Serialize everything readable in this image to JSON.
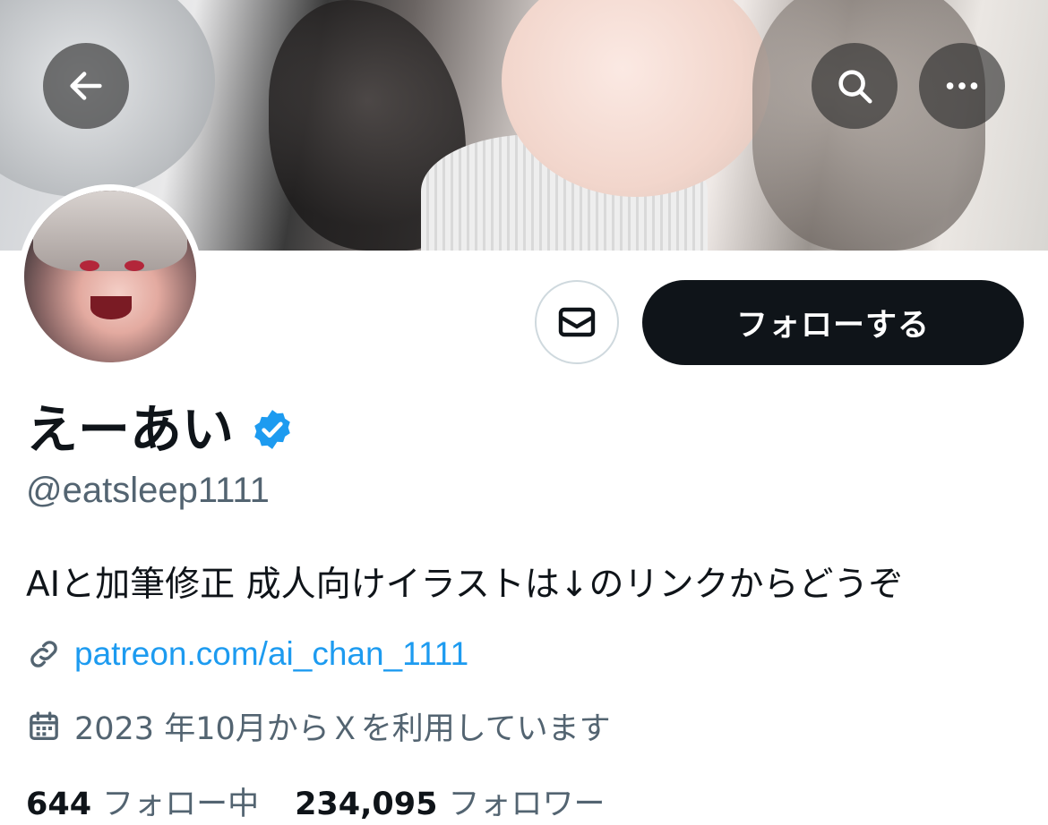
{
  "header": {
    "back_icon": "arrow-left-icon",
    "search_icon": "search-icon",
    "more_icon": "more-horizontal-icon"
  },
  "profile": {
    "name": "えーあい",
    "verified": true,
    "handle": "@eatsleep1111",
    "bio": "AIと加筆修正 成人向けイラストは↓のリンクからどうぞ",
    "link": "patreon.com/ai_chan_1111",
    "joined": "2023 年10月からＸを利用しています",
    "following_count": "644",
    "following_label": "フォロー中",
    "followers_count": "234,095",
    "followers_label": "フォロワー"
  },
  "actions": {
    "message_icon": "mail-icon",
    "follow_label": "フォローする"
  },
  "colors": {
    "link": "#1d9bf0",
    "secondary_text": "#536471",
    "primary_text": "#0f1419",
    "follow_button_bg": "#0f1419",
    "verified_badge": "#1d9bf0"
  }
}
